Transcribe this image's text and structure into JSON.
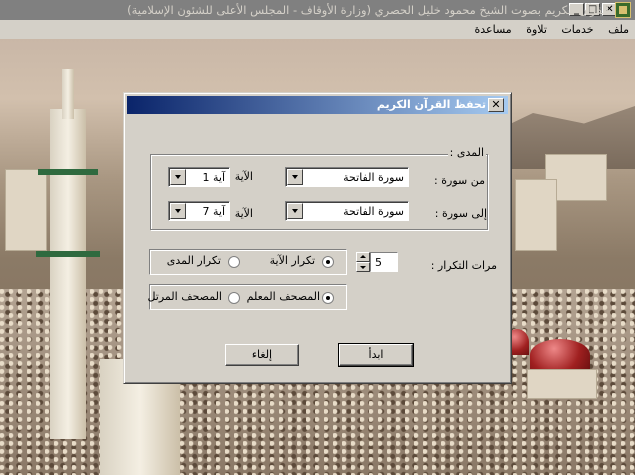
{
  "window": {
    "title": "القرآن الكريم بصوت الشيخ محمود خليل الحصري (وزارة الأوقاف - المجلس الأعلى للشئون الإسلامية)",
    "minimize": "_",
    "maximize": "□",
    "close": "✕"
  },
  "menu": {
    "items": [
      "ملف",
      "خدمات",
      "تلاوة",
      "مساعدة"
    ]
  },
  "dialog": {
    "title": "تحفظ القرآن الكريم",
    "close": "✕",
    "range_group": "المدى :",
    "from_surah_label": "من سورة :",
    "from_surah_value": "سورة الفاتحة",
    "from_ayah_label": "الآية :",
    "from_ayah_value": "آية 1",
    "to_surah_label": "إلى سورة :",
    "to_surah_value": "سورة الفاتحة",
    "to_ayah_label": "الآية :",
    "to_ayah_value": "آية 7",
    "repeat_count_label": "مرات التكرار :",
    "repeat_count_value": "5",
    "repeat_ayah": "تكرار الآية",
    "repeat_range": "تكرار المدى",
    "mushaf_teacher": "المصحف المعلم",
    "mushaf_murattal": "المصحف المرتل",
    "start_button": "ابدأ",
    "cancel_button": "إلغاء"
  }
}
